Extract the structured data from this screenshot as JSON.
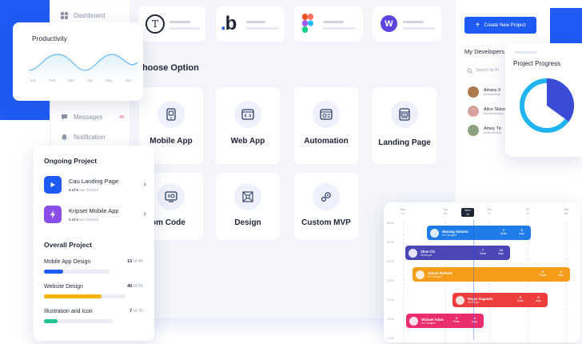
{
  "sidebar": {
    "items": [
      {
        "label": "Dashboard",
        "icon": "grid-icon"
      },
      {
        "label": "Messages",
        "icon": "message-icon",
        "badge": "09"
      },
      {
        "label": "Notification",
        "icon": "bell-icon"
      }
    ]
  },
  "productivity": {
    "title": "Productivity",
    "months": [
      "Jan",
      "Feb",
      "Mar",
      "Apr",
      "May",
      "Jun"
    ]
  },
  "top_apps": [
    {
      "name": "typeform",
      "glyph": "T"
    },
    {
      "name": "bootstrap",
      "glyph": ".b"
    },
    {
      "name": "figma",
      "glyph": ""
    },
    {
      "name": "webflow",
      "glyph": "W"
    }
  ],
  "choose": {
    "title": "Choose Option",
    "options": [
      {
        "label": "Mobile App",
        "icon": "mobile-icon"
      },
      {
        "label": "Web App",
        "icon": "code-window-icon"
      },
      {
        "label": "Automation",
        "icon": "automation-icon"
      },
      {
        "label": "Landing Page",
        "icon": "layout-icon"
      },
      {
        "label": "Custom Code",
        "display": "ustom Code",
        "icon": "code-gear-icon"
      },
      {
        "label": "Design",
        "icon": "design-icon"
      },
      {
        "label": "Custom MVP",
        "icon": "gear-settings-icon"
      }
    ]
  },
  "create_button": {
    "label": "Create New Project"
  },
  "developers": {
    "title": "My Developers",
    "search_placeholder": "Search for Pr",
    "items": [
      {
        "name": "Amara X",
        "email": "ebowkuad@",
        "color": "#b07a4f"
      },
      {
        "name": "Alice Skinn",
        "email": "ebowkuad@go",
        "color": "#d7a59f"
      },
      {
        "name": "Amey Tic",
        "email": "buchevicar@",
        "color": "#8aa07e"
      }
    ]
  },
  "project_progress": {
    "title": "Project Progress",
    "percent": 35
  },
  "ongoing": {
    "title": "Ongoing Project",
    "items": [
      {
        "title": "Cau Landing Page",
        "progress_bold": "4 of 5",
        "progress_rest": "has finished",
        "color": "#1e5bf5",
        "icon": "play-icon"
      },
      {
        "title": "Kripset Mobile App",
        "progress_bold": "2 of 3",
        "progress_rest": "has finished",
        "color": "#8b4de8",
        "icon": "bolt-icon"
      }
    ]
  },
  "overall": {
    "title": "Overall Project",
    "items": [
      {
        "label": "App Design",
        "prefix": "Mobile ",
        "count": "13",
        "total": "of 45",
        "fraction": 0.29,
        "color": "#1e5bf5"
      },
      {
        "label": "Website Design",
        "prefix": "",
        "count": "40",
        "total": "of 56",
        "fraction": 0.71,
        "color": "#f5b400"
      },
      {
        "label": "Illustration and Icon",
        "prefix": "",
        "count": "7",
        "total": "of 35",
        "fraction": 0.2,
        "color": "#22c38e"
      }
    ]
  },
  "gantt": {
    "header": [
      {
        "day": "Mon",
        "date": "14"
      },
      {
        "day": "Tue",
        "date": "15"
      },
      {
        "day": "Wed",
        "date": "16"
      },
      {
        "day": "Thu",
        "date": "17"
      },
      {
        "day": "Fri",
        "date": "17"
      },
      {
        "day": "Sat",
        "date": "18"
      }
    ],
    "times": [
      "08:00",
      "09:00",
      "10:00",
      "11:00",
      "12:00",
      "13:00",
      "14:00"
    ],
    "bars": [
      {
        "name": "Manang Sutarno",
        "role": "UX Designer",
        "tasks": "4",
        "days": "5",
        "color": "#1e7be8"
      },
      {
        "name": "Shoe Chi",
        "role": "Developer",
        "tasks": "7",
        "days": "13",
        "color": "#4a46b8"
      },
      {
        "name": "Zainah Rutherd",
        "role": "UX Designer",
        "tasks": "5",
        "days": "4",
        "color": "#f59c1a"
      },
      {
        "name": "Rayya Sugandu",
        "role": "Developer",
        "tasks": "5",
        "days": "5",
        "color": "#ee3d3d"
      },
      {
        "name": "Michael Adam",
        "role": "UX Designer",
        "tasks": "3",
        "days": "4",
        "color": "#ea2e6b"
      }
    ],
    "stat_labels": {
      "tasks": "Tasks",
      "days": "days"
    }
  }
}
